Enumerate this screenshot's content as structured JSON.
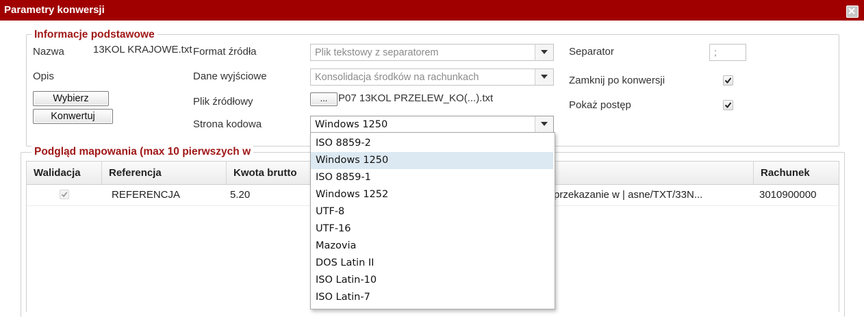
{
  "window": {
    "title": "Parametry konwersji"
  },
  "basic": {
    "legend": "Informacje podstawowe",
    "name_label": "Nazwa",
    "name_value": "13KOL KRAJOWE.txt",
    "desc_label": "Opis",
    "select_button": "Wybierz",
    "convert_button": "Konwertuj",
    "source_format_label": "Format źródła",
    "source_format_value": "Plik tekstowy z separatorem",
    "output_label": "Dane wyjściowe",
    "output_value": "Konsolidacja środków na rachunkach",
    "source_file_label": "Plik źródłowy",
    "browse_button": "...",
    "source_file_value": "P07 13KOL PRZELEW_KO(...).txt",
    "codepage_label": "Strona kodowa",
    "codepage_value": "Windows 1250",
    "separator_label": "Separator",
    "separator_value": ";",
    "close_after_label": "Zamknij po konwersji",
    "close_after_checked": true,
    "show_progress_label": "Pokaż postęp",
    "show_progress_checked": true
  },
  "preview": {
    "legend": "Podgląd mapowania (max 10 pierwszych w",
    "columns": [
      "Walidacja",
      "Referencja",
      "Kwota brutto",
      "Rachunek "
    ],
    "rows": [
      {
        "validated": true,
        "reference": "REFERENCJA",
        "amount": "5.20",
        "title_fragment": "przekazanie w | asne/TXT/33N...",
        "account": "3010900000"
      }
    ]
  },
  "codepage_dropdown": {
    "options": [
      "ISO 8859-2",
      "Windows 1250",
      "ISO 8859-1",
      "Windows 1252",
      "UTF-8",
      "UTF-16",
      "Mazovia",
      "DOS Latin II",
      "ISO Latin-10",
      "ISO Latin-7"
    ],
    "selected_index": 1
  },
  "colors": {
    "titlebar": "#a00000",
    "legend": "#a01818",
    "selected_option": "#dde9f2"
  }
}
